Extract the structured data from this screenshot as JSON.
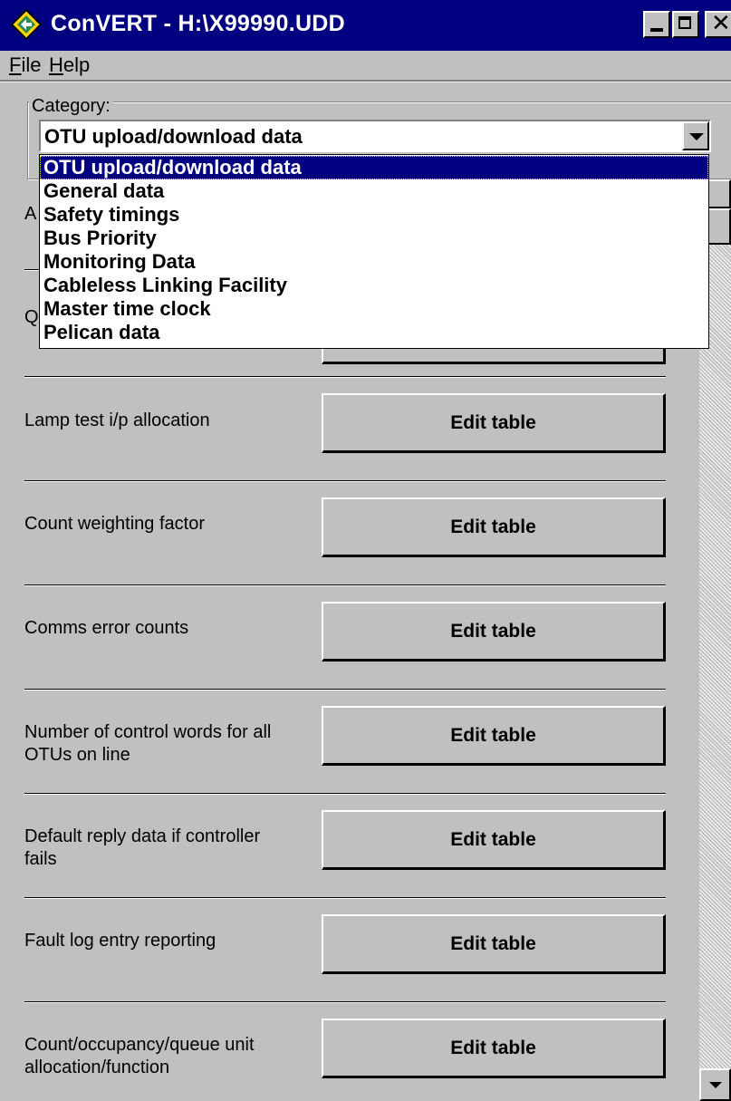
{
  "window": {
    "title": "ConVERT - H:\\X99990.UDD",
    "app_icon": "diamond-icon",
    "controls": {
      "minimize": "minimize-icon",
      "maximize": "maximize-icon",
      "close": "✕"
    }
  },
  "menubar": {
    "file": {
      "label": "File",
      "mnemonic": "F",
      "rest": "ile"
    },
    "help": {
      "label": "Help",
      "mnemonic": "H",
      "rest": "elp"
    }
  },
  "category": {
    "label": "Category:",
    "selected": "OTU upload/download data",
    "options": [
      "OTU upload/download data",
      "General data",
      "Safety timings",
      "Bus Priority",
      "Monitoring Data",
      "Cableless Linking Facility",
      "Master time clock",
      "Pelican data"
    ]
  },
  "partial_labels": {
    "first": "A",
    "second": "Q"
  },
  "rows": [
    {
      "label": "Lamp test i/p allocation",
      "button": "Edit table"
    },
    {
      "label": "Count weighting factor",
      "button": "Edit table"
    },
    {
      "label": "Comms error counts",
      "button": "Edit table"
    },
    {
      "label": "Number of control words for all OTUs on line",
      "button": "Edit table"
    },
    {
      "label": "Default reply data if controller fails",
      "button": "Edit table"
    },
    {
      "label": "Fault log entry reporting",
      "button": "Edit table"
    },
    {
      "label": "Count/occupancy/queue unit allocation/function",
      "button": "Edit table"
    }
  ],
  "colors": {
    "titlebar": "#000080",
    "face": "#c0c0c0",
    "highlight": "#000080"
  }
}
